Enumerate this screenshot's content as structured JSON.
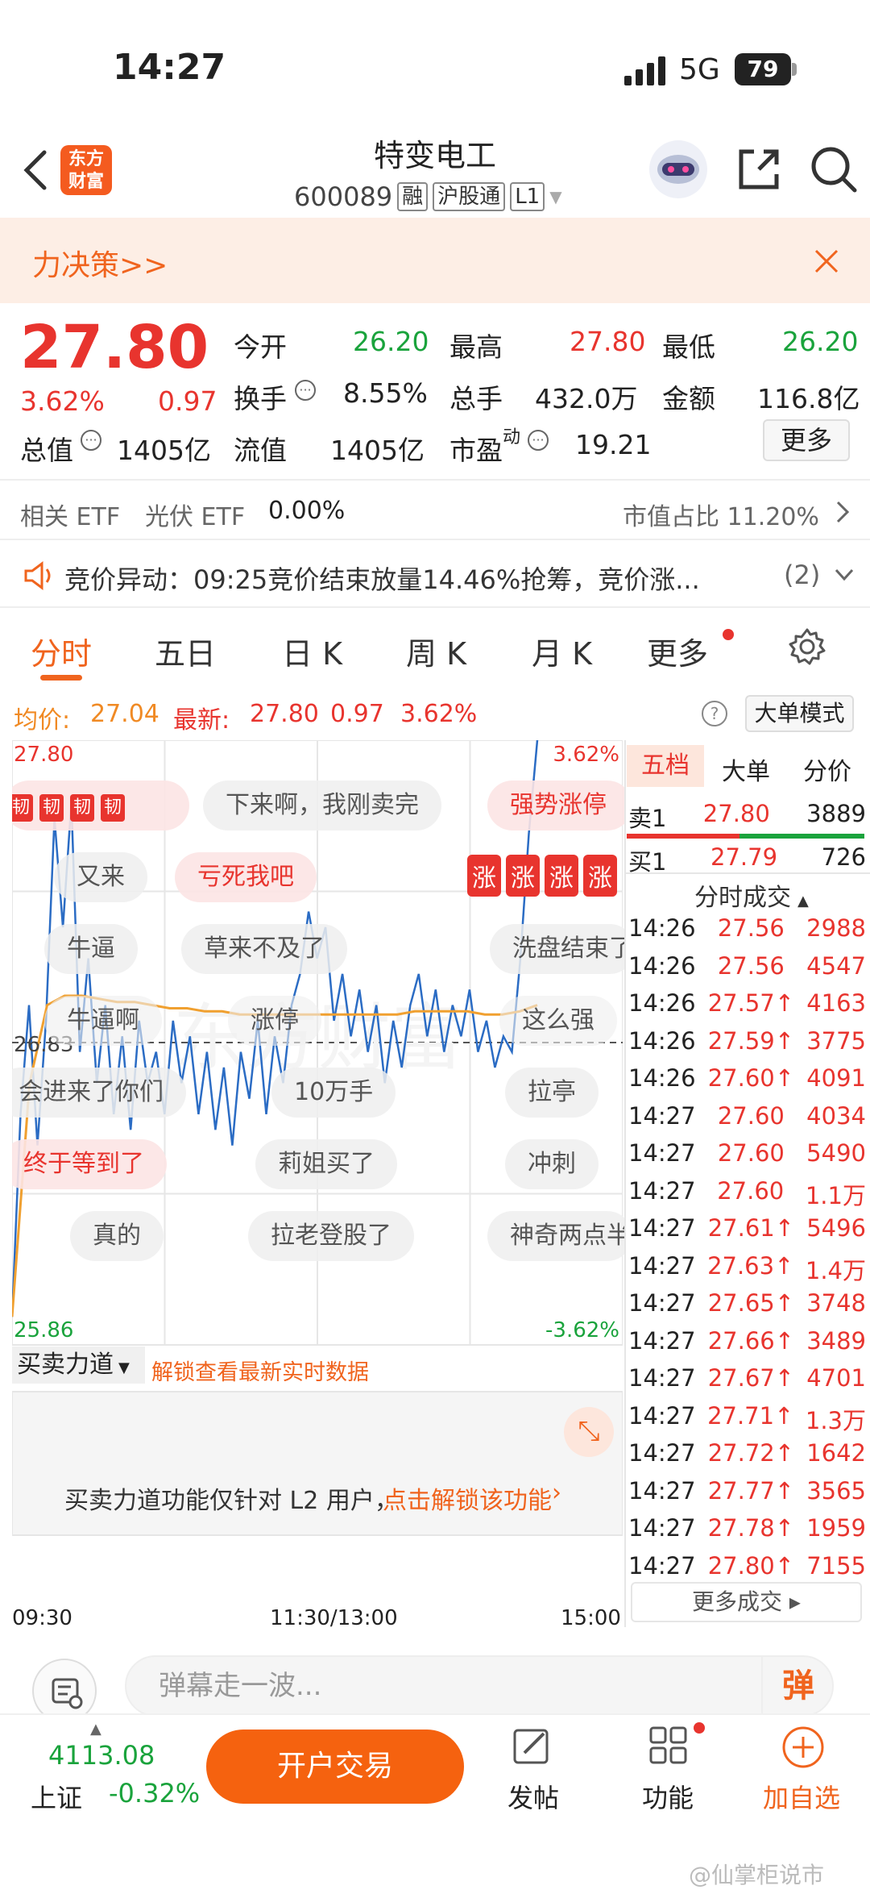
{
  "status_bar": {
    "time": "14:27",
    "network": "5G",
    "battery": "79"
  },
  "header": {
    "logo_line1": "东方",
    "logo_line2": "财富",
    "stock_name": "特变电工",
    "stock_code": "600089",
    "tags": [
      "融",
      "沪股通",
      "L1"
    ]
  },
  "banner": {
    "text": "力决策>>"
  },
  "quote": {
    "price": "27.80",
    "change_pct": "3.62%",
    "change": "0.97",
    "open_label": "今开",
    "open": "26.20",
    "high_label": "最高",
    "high": "27.80",
    "low_label": "最低",
    "low": "26.20",
    "turnover_label": "换手",
    "turnover": "8.55%",
    "volume_label": "总手",
    "volume": "432.0万",
    "amount_label": "金额",
    "amount": "116.8亿",
    "total_value_label": "总值",
    "total_value": "1405亿",
    "float_value_label": "流值",
    "float_value": "1405亿",
    "pe_label": "市盈",
    "pe_sup": "动",
    "pe": "19.21",
    "more_label": "更多"
  },
  "etf": {
    "related_label": "相关 ETF",
    "etf_name": "光伏 ETF",
    "etf_change": "0.00%",
    "share_label": "市值占比 11.20%"
  },
  "alert": {
    "text": "竞价异动：09:25竞价结束放量14.46%抢筹，竞价涨...",
    "count": "(2)"
  },
  "tabs": {
    "fenshi": "分时",
    "wuri": "五日",
    "rik": "日 K",
    "zhouk": "周 K",
    "yuek": "月 K",
    "more": "更多"
  },
  "chart_info": {
    "avg_label": "均价:",
    "avg": "27.04",
    "latest_label": "最新:",
    "latest": "27.80",
    "latest_change": "0.97",
    "latest_pct": "3.62%",
    "mode_button": "大单模式"
  },
  "chart_data": {
    "type": "line",
    "title": "",
    "ylim": [
      25.86,
      27.8
    ],
    "y_top_label": "27.80",
    "y_bottom_label": "25.86",
    "y_ref_label": "26.83",
    "pct_top_label": "3.62%",
    "pct_bottom_label": "-3.62%",
    "x_ticks": [
      "09:30",
      "11:30/13:00",
      "15:00"
    ],
    "series": [
      {
        "values": [
          25.95,
          26.6,
          26.95,
          26.5,
          26.9,
          27.55,
          27.2,
          27.6,
          26.8,
          27.1,
          26.7,
          26.95,
          26.6,
          26.85,
          26.55,
          26.9,
          26.7,
          26.8,
          26.6,
          26.9,
          26.7,
          26.85,
          26.6,
          26.8,
          26.55,
          26.75,
          26.5,
          26.8,
          26.65,
          26.9,
          26.6,
          26.85,
          26.7,
          26.95,
          27.05,
          27.25,
          27.1,
          27.2,
          26.9,
          27.05,
          26.85,
          27.0,
          26.8,
          26.95,
          26.7,
          26.9,
          26.75,
          26.95,
          27.05,
          26.85,
          27.0,
          26.8,
          26.95,
          26.85,
          27.0,
          26.8,
          26.9,
          26.75,
          26.85,
          26.8,
          27.1,
          27.5,
          27.8
        ]
      },
      {
        "values": [
          25.95,
          26.7,
          26.95,
          26.98,
          26.98,
          26.97,
          26.96,
          26.96,
          26.95,
          26.94,
          26.94,
          26.93,
          26.93,
          26.92,
          26.92,
          26.92,
          26.92,
          26.92,
          26.92,
          26.92,
          26.92,
          26.92,
          26.92,
          26.93,
          26.93,
          26.93,
          26.93,
          26.92,
          26.92,
          26.93,
          26.95
        ]
      }
    ]
  },
  "danmu": {
    "row1": [
      "下来啊，我刚卖完",
      "强势涨停"
    ],
    "row2": [
      "又来",
      "亏死我吧"
    ],
    "row3": [
      "牛逼",
      "草来不及了",
      "洗盘结束了"
    ],
    "row4": [
      "牛逼啊",
      "涨停",
      "这么强"
    ],
    "row5": [
      "会进来了你们",
      "10万手",
      "拉亭"
    ],
    "row6": [
      "终于等到了",
      "莉姐买了",
      "冲刺"
    ],
    "row7": [
      "真的",
      "拉老登股了",
      "神奇两点半"
    ],
    "badge_ren": "韧",
    "badge_zhang": "涨"
  },
  "force": {
    "label": "买卖力道",
    "unlock_hint": "解锁查看最新实时数据",
    "body": "买卖力道功能仅针对 L2 用户，",
    "link": "点击解锁该功能"
  },
  "right_panel": {
    "tabs": [
      "五档",
      "大单",
      "分价"
    ],
    "sell1": {
      "label": "卖1",
      "price": "27.80",
      "vol": "3889"
    },
    "buy1": {
      "label": "买1",
      "price": "27.79",
      "vol": "726"
    },
    "trades_title": "分时成交",
    "trades": [
      {
        "time": "14:26",
        "price": "27.56",
        "vol": "2988"
      },
      {
        "time": "14:26",
        "price": "27.56",
        "vol": "4547"
      },
      {
        "time": "14:26",
        "price": "27.57↑",
        "vol": "4163"
      },
      {
        "time": "14:26",
        "price": "27.59↑",
        "vol": "3775"
      },
      {
        "time": "14:26",
        "price": "27.60↑",
        "vol": "4091"
      },
      {
        "time": "14:27",
        "price": "27.60",
        "vol": "4034"
      },
      {
        "time": "14:27",
        "price": "27.60",
        "vol": "5490"
      },
      {
        "time": "14:27",
        "price": "27.60",
        "vol": "1.1万"
      },
      {
        "time": "14:27",
        "price": "27.61↑",
        "vol": "5496"
      },
      {
        "time": "14:27",
        "price": "27.63↑",
        "vol": "1.4万"
      },
      {
        "time": "14:27",
        "price": "27.65↑",
        "vol": "3748"
      },
      {
        "time": "14:27",
        "price": "27.66↑",
        "vol": "3489"
      },
      {
        "time": "14:27",
        "price": "27.67↑",
        "vol": "4701"
      },
      {
        "time": "14:27",
        "price": "27.71↑",
        "vol": "1.3万"
      },
      {
        "time": "14:27",
        "price": "27.72↑",
        "vol": "1642"
      },
      {
        "time": "14:27",
        "price": "27.77↑",
        "vol": "3565"
      },
      {
        "time": "14:27",
        "price": "27.78↑",
        "vol": "1959"
      },
      {
        "time": "14:27",
        "price": "27.80↑",
        "vol": "7155"
      }
    ],
    "more_trades": "更多成交"
  },
  "danmu_input": {
    "placeholder": "弹幕走一波...",
    "send_label": "弹"
  },
  "bottom": {
    "index_value": "4113.08",
    "index_name": "上证",
    "index_change": "-0.32%",
    "open_trade": "开户交易",
    "post": "发帖",
    "functions": "功能",
    "add_watch": "加自选"
  },
  "watermark": "@仙掌柜说市",
  "colors": {
    "red": "#e8342e",
    "green": "#1aa33c",
    "orange": "#f0641e",
    "line_blue": "#2b6cc4",
    "avg_orange": "#f0a030"
  }
}
